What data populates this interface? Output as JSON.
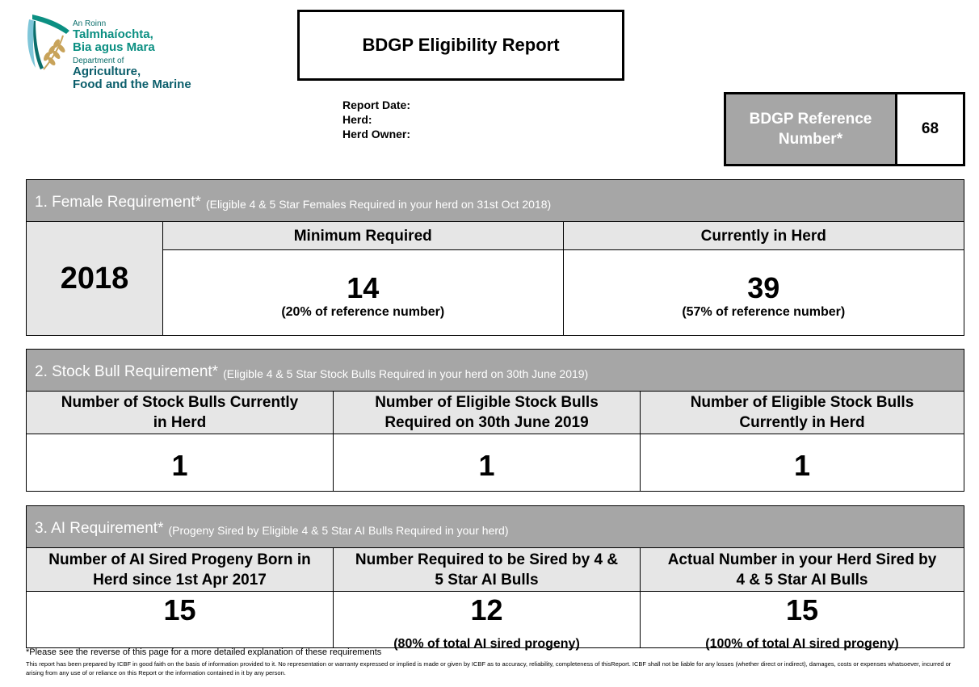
{
  "logo": {
    "ga_small": "An Roinn",
    "ga_line1": "Talmhaíochta,",
    "ga_line2": "Bia agus Mara",
    "en_small": "Department of",
    "en_line1": "Agriculture,",
    "en_line2": "Food and the Marine",
    "colors": {
      "teal": "#0b8f82",
      "dark_teal": "#0b6e6b",
      "gold": "#c8a35a"
    }
  },
  "title": "BDGP Eligibility Report",
  "meta": {
    "report_date_label": "Report Date:",
    "herd_label": "Herd:",
    "herd_owner_label": "Herd Owner:"
  },
  "reference": {
    "label": "BDGP Reference Number*",
    "value": "68"
  },
  "section1": {
    "title": "1. Female Requirement*",
    "subtitle": "(Eligible 4 & 5 Star Females Required in your herd on 31st Oct 2018)",
    "year": "2018",
    "col1_header": "Minimum Required",
    "col2_header": "Currently in Herd",
    "col1_value": "14",
    "col1_note": "(20% of reference number)",
    "col2_value": "39",
    "col2_note": "(57% of reference number)"
  },
  "section2": {
    "title": "2. Stock Bull Requirement*",
    "subtitle": "(Eligible 4 & 5 Star Stock Bulls Required in your herd on 30th June 2019)",
    "col1_header_a": "Number of Stock Bulls Currently",
    "col1_header_b": "in Herd",
    "col2_header_a": "Number of Eligible Stock Bulls",
    "col2_header_b": "Required on 30th June 2019",
    "col3_header_a": "Number of Eligible Stock Bulls",
    "col3_header_b": "Currently in Herd",
    "col1_value": "1",
    "col2_value": "1",
    "col3_value": "1"
  },
  "section3": {
    "title": "3. AI Requirement*",
    "subtitle": "(Progeny Sired by Eligible 4 & 5 Star AI Bulls Required in your herd)",
    "col1_header_a": "Number of AI Sired Progeny Born in",
    "col1_header_b": "Herd since 1st Apr 2017",
    "col2_header_a": "Number Required to be Sired by 4 &",
    "col2_header_b": "5 Star AI Bulls",
    "col3_header_a": "Actual Number in your Herd Sired by",
    "col3_header_b": "4 & 5 Star AI Bulls",
    "col1_value": "15",
    "col2_value": "12",
    "col2_note": "(80% of total AI sired progeny)",
    "col3_value": "15",
    "col3_note": "(100% of total AI sired progeny)"
  },
  "footer": {
    "note": "*Please see the reverse of this page for a more detailed explanation of these requirements",
    "disclaimer": "This report has been prepared by ICBF in good faith on the basis of information provided to it. No representation or warranty expressed or implied is made or given by ICBF as to accuracy, reliability, completeness of thisReport. ICBF shall not be liable for any losses (whether direct or indirect), damages, costs or expenses whatsoever, incurred or arising from any use of or reliance on this Report or the information contained in it by any person."
  }
}
